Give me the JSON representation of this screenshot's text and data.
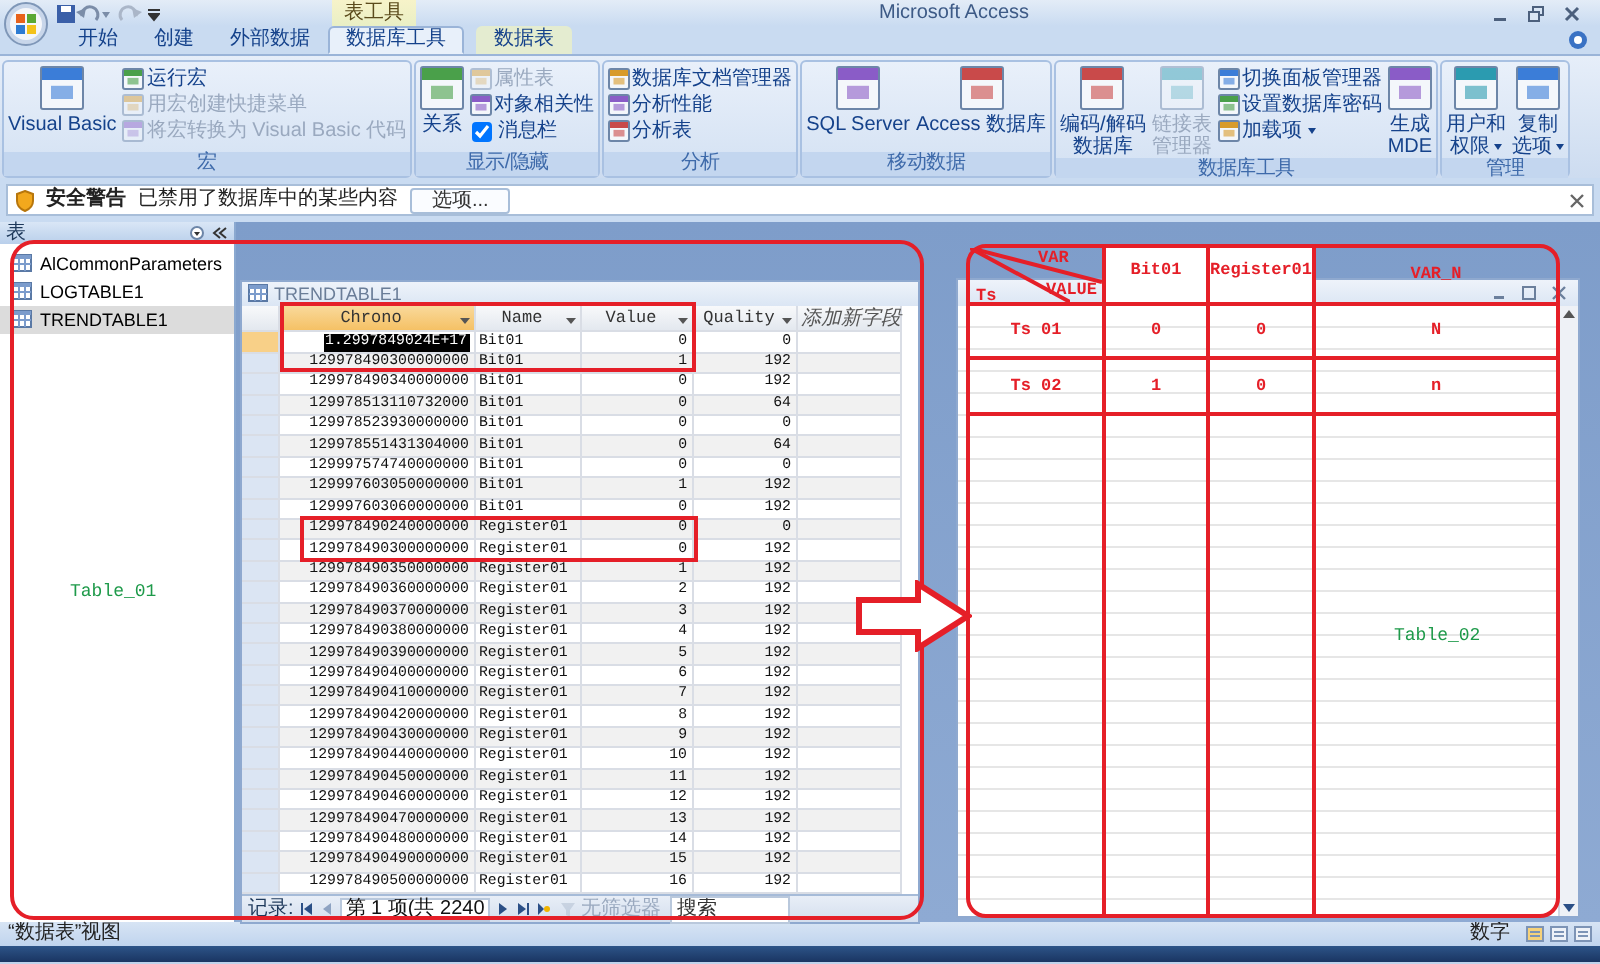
{
  "window": {
    "title": "Microsoft Access",
    "context_tab": "表工具"
  },
  "ribbon_tabs": [
    {
      "label": "开始",
      "selected": false,
      "contextual": false
    },
    {
      "label": "创建",
      "selected": false,
      "contextual": false
    },
    {
      "label": "外部数据",
      "selected": false,
      "contextual": false
    },
    {
      "label": "数据库工具",
      "selected": true,
      "contextual": false
    },
    {
      "label": "数据表",
      "selected": false,
      "contextual": true
    }
  ],
  "ribbon_groups": [
    {
      "label": "宏",
      "items": [
        {
          "kind": "large",
          "lines": [
            "Visual Basic"
          ],
          "disabled": false,
          "dropdown": false
        },
        {
          "kind": "small",
          "label": "运行宏",
          "disabled": false,
          "dropdown": false
        },
        {
          "kind": "small",
          "label": "用宏创建快捷菜单",
          "disabled": true,
          "dropdown": false
        },
        {
          "kind": "small",
          "label": "将宏转换为 Visual Basic 代码",
          "disabled": true,
          "dropdown": false
        }
      ]
    },
    {
      "label": "显示/隐藏",
      "items": [
        {
          "kind": "large",
          "lines": [
            "关系"
          ],
          "disabled": false,
          "dropdown": false
        },
        {
          "kind": "small",
          "label": "属性表",
          "disabled": true,
          "dropdown": false
        },
        {
          "kind": "small",
          "label": "对象相关性",
          "disabled": false,
          "dropdown": false
        },
        {
          "kind": "check",
          "label": "消息栏",
          "disabled": false,
          "dropdown": false,
          "checked": true
        }
      ]
    },
    {
      "label": "分析",
      "items": [
        {
          "kind": "small",
          "label": "数据库文档管理器",
          "disabled": false,
          "dropdown": false
        },
        {
          "kind": "small",
          "label": "分析性能",
          "disabled": false,
          "dropdown": false
        },
        {
          "kind": "small",
          "label": "分析表",
          "disabled": false,
          "dropdown": false
        }
      ]
    },
    {
      "label": "移动数据",
      "items": [
        {
          "kind": "large",
          "lines": [
            "SQL Server"
          ],
          "disabled": false,
          "dropdown": false
        },
        {
          "kind": "large",
          "lines": [
            "Access 数据库"
          ],
          "disabled": false,
          "dropdown": false
        }
      ]
    },
    {
      "label": "数据库工具",
      "items": [
        {
          "kind": "large",
          "lines": [
            "编码/解码",
            "数据库"
          ],
          "disabled": false,
          "dropdown": false
        },
        {
          "kind": "large",
          "lines": [
            "链接表",
            "管理器"
          ],
          "disabled": true,
          "dropdown": false
        },
        {
          "kind": "small",
          "label": "切换面板管理器",
          "disabled": false,
          "dropdown": false
        },
        {
          "kind": "small",
          "label": "设置数据库密码",
          "disabled": false,
          "dropdown": false
        },
        {
          "kind": "small",
          "label": "加载项",
          "disabled": false,
          "dropdown": true
        },
        {
          "kind": "large",
          "lines": [
            "生成",
            "MDE"
          ],
          "disabled": false,
          "dropdown": false
        }
      ]
    },
    {
      "label": "管理",
      "items": [
        {
          "kind": "large",
          "lines": [
            "用户和",
            "权限"
          ],
          "disabled": false,
          "dropdown": true
        },
        {
          "kind": "large",
          "lines": [
            "复制",
            "选项"
          ],
          "disabled": false,
          "dropdown": true
        }
      ]
    }
  ],
  "message_bar": {
    "title": "安全警告",
    "text": "已禁用了数据库中的某些内容",
    "button": "选项..."
  },
  "nav_pane": {
    "header": "表",
    "items": [
      {
        "label": "AlCommonParameters",
        "selected": false
      },
      {
        "label": "LOGTABLE1",
        "selected": false
      },
      {
        "label": "TRENDTABLE1",
        "selected": true
      }
    ]
  },
  "datasheet": {
    "title": "TRENDTABLE1",
    "columns": [
      {
        "label": "Chrono",
        "selected": true
      },
      {
        "label": "Name",
        "selected": false
      },
      {
        "label": "Value",
        "selected": false
      },
      {
        "label": "Quality",
        "selected": false
      }
    ],
    "new_field": "添加新字段",
    "rows": [
      {
        "selected": true,
        "cells": [
          "1.2997849024E+17",
          "Bit01",
          "0",
          "0"
        ]
      },
      {
        "selected": false,
        "cells": [
          "129978490300000000",
          "Bit01",
          "1",
          "192"
        ]
      },
      {
        "selected": false,
        "cells": [
          "129978490340000000",
          "Bit01",
          "0",
          "192"
        ]
      },
      {
        "selected": false,
        "cells": [
          "129978513110732000",
          "Bit01",
          "0",
          "64"
        ]
      },
      {
        "selected": false,
        "cells": [
          "129978523930000000",
          "Bit01",
          "0",
          "0"
        ]
      },
      {
        "selected": false,
        "cells": [
          "129978551431304000",
          "Bit01",
          "0",
          "64"
        ]
      },
      {
        "selected": false,
        "cells": [
          "129997574740000000",
          "Bit01",
          "0",
          "0"
        ]
      },
      {
        "selected": false,
        "cells": [
          "129997603050000000",
          "Bit01",
          "1",
          "192"
        ]
      },
      {
        "selected": false,
        "cells": [
          "129997603060000000",
          "Bit01",
          "0",
          "192"
        ]
      },
      {
        "selected": false,
        "cells": [
          "129978490240000000",
          "Register01",
          "0",
          "0"
        ]
      },
      {
        "selected": false,
        "cells": [
          "129978490300000000",
          "Register01",
          "0",
          "192"
        ]
      },
      {
        "selected": false,
        "cells": [
          "129978490350000000",
          "Register01",
          "1",
          "192"
        ]
      },
      {
        "selected": false,
        "cells": [
          "129978490360000000",
          "Register01",
          "2",
          "192"
        ]
      },
      {
        "selected": false,
        "cells": [
          "129978490370000000",
          "Register01",
          "3",
          "192"
        ]
      },
      {
        "selected": false,
        "cells": [
          "129978490380000000",
          "Register01",
          "4",
          "192"
        ]
      },
      {
        "selected": false,
        "cells": [
          "129978490390000000",
          "Register01",
          "5",
          "192"
        ]
      },
      {
        "selected": false,
        "cells": [
          "129978490400000000",
          "Register01",
          "6",
          "192"
        ]
      },
      {
        "selected": false,
        "cells": [
          "129978490410000000",
          "Register01",
          "7",
          "192"
        ]
      },
      {
        "selected": false,
        "cells": [
          "129978490420000000",
          "Register01",
          "8",
          "192"
        ]
      },
      {
        "selected": false,
        "cells": [
          "129978490430000000",
          "Register01",
          "9",
          "192"
        ]
      },
      {
        "selected": false,
        "cells": [
          "129978490440000000",
          "Register01",
          "10",
          "192"
        ]
      },
      {
        "selected": false,
        "cells": [
          "129978490450000000",
          "Register01",
          "11",
          "192"
        ]
      },
      {
        "selected": false,
        "cells": [
          "129978490460000000",
          "Register01",
          "12",
          "192"
        ]
      },
      {
        "selected": false,
        "cells": [
          "129978490470000000",
          "Register01",
          "13",
          "192"
        ]
      },
      {
        "selected": false,
        "cells": [
          "129978490480000000",
          "Register01",
          "14",
          "192"
        ]
      },
      {
        "selected": false,
        "cells": [
          "129978490490000000",
          "Register01",
          "15",
          "192"
        ]
      },
      {
        "selected": false,
        "cells": [
          "129978490500000000",
          "Register01",
          "16",
          "192"
        ]
      }
    ],
    "record_nav": {
      "label": "记录:",
      "position": "第 1 项(共 2240",
      "filter": "无筛选器",
      "filter_disabled": true,
      "search_placeholder": "搜索"
    }
  },
  "annotations": {
    "labels": [
      "Table_01",
      "Table_02"
    ],
    "table": {
      "corner": {
        "top": "VAR",
        "middle": "VALUE",
        "left": "Ts"
      },
      "columns": [
        "Bit01",
        "Register01",
        "VAR_N"
      ],
      "rows": [
        {
          "label": "Ts 01",
          "values": [
            "0",
            "0",
            "N"
          ]
        },
        {
          "label": "Ts 02",
          "values": [
            "1",
            "0",
            "n"
          ]
        }
      ]
    }
  },
  "status_bar": {
    "view": "“数据表”视图",
    "mode": "数字"
  }
}
